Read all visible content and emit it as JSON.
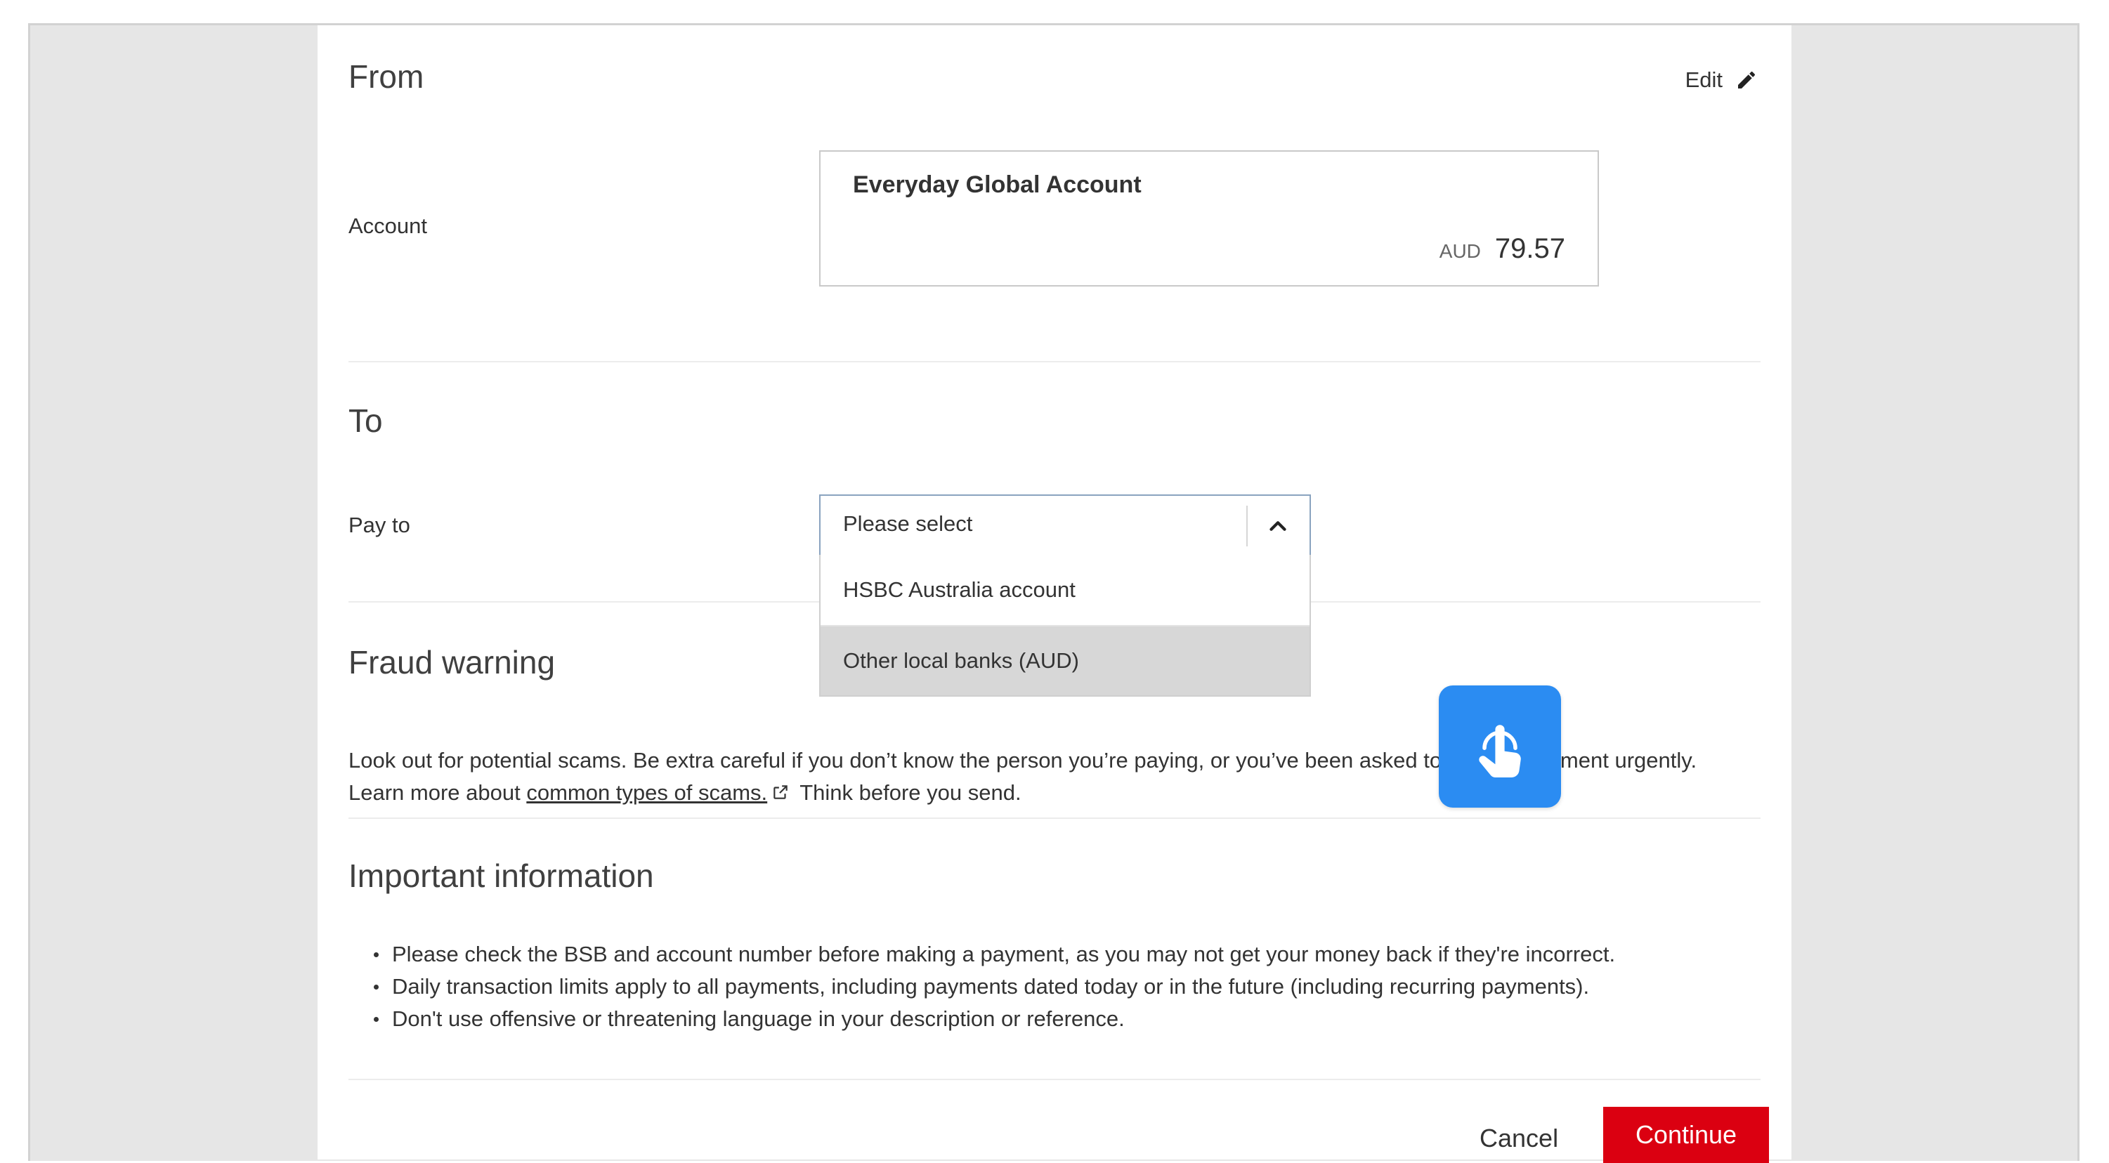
{
  "from": {
    "heading": "From",
    "edit_label": "Edit",
    "account_label": "Account",
    "account": {
      "name": "Everyday Global Account",
      "currency": "AUD",
      "balance": "79.57"
    }
  },
  "to": {
    "heading": "To",
    "pay_to_label": "Pay to",
    "select": {
      "value": "Please select",
      "options": [
        "HSBC Australia account",
        "Other local banks (AUD)"
      ],
      "highlighted_option": "Other local banks (AUD)"
    }
  },
  "fraud": {
    "heading": "Fraud warning",
    "text_before": "Look out for potential scams. Be extra careful if you don’t know the person you’re paying, or you’ve been asked to make a payment urgently. Learn more about ",
    "link_text": "common types of scams.",
    "text_after": " Think before you send."
  },
  "important": {
    "heading": "Important information",
    "items": [
      "Please check the BSB and account number before making a payment, as you may not get your money back if they're incorrect.",
      "Daily transaction limits apply to all payments, including payments dated today or in the future (including recurring payments).",
      "Don't use offensive or threatening language in your description or reference."
    ]
  },
  "actions": {
    "cancel_label": "Cancel",
    "continue_label": "Continue"
  },
  "colors": {
    "brand_red": "#db0011",
    "touch_blue": "#2b8cf2",
    "frame_gray": "#e6e6e6"
  },
  "icons": [
    "pencil-icon",
    "chevron-up-icon",
    "external-link-icon",
    "touch-pointer-icon"
  ]
}
